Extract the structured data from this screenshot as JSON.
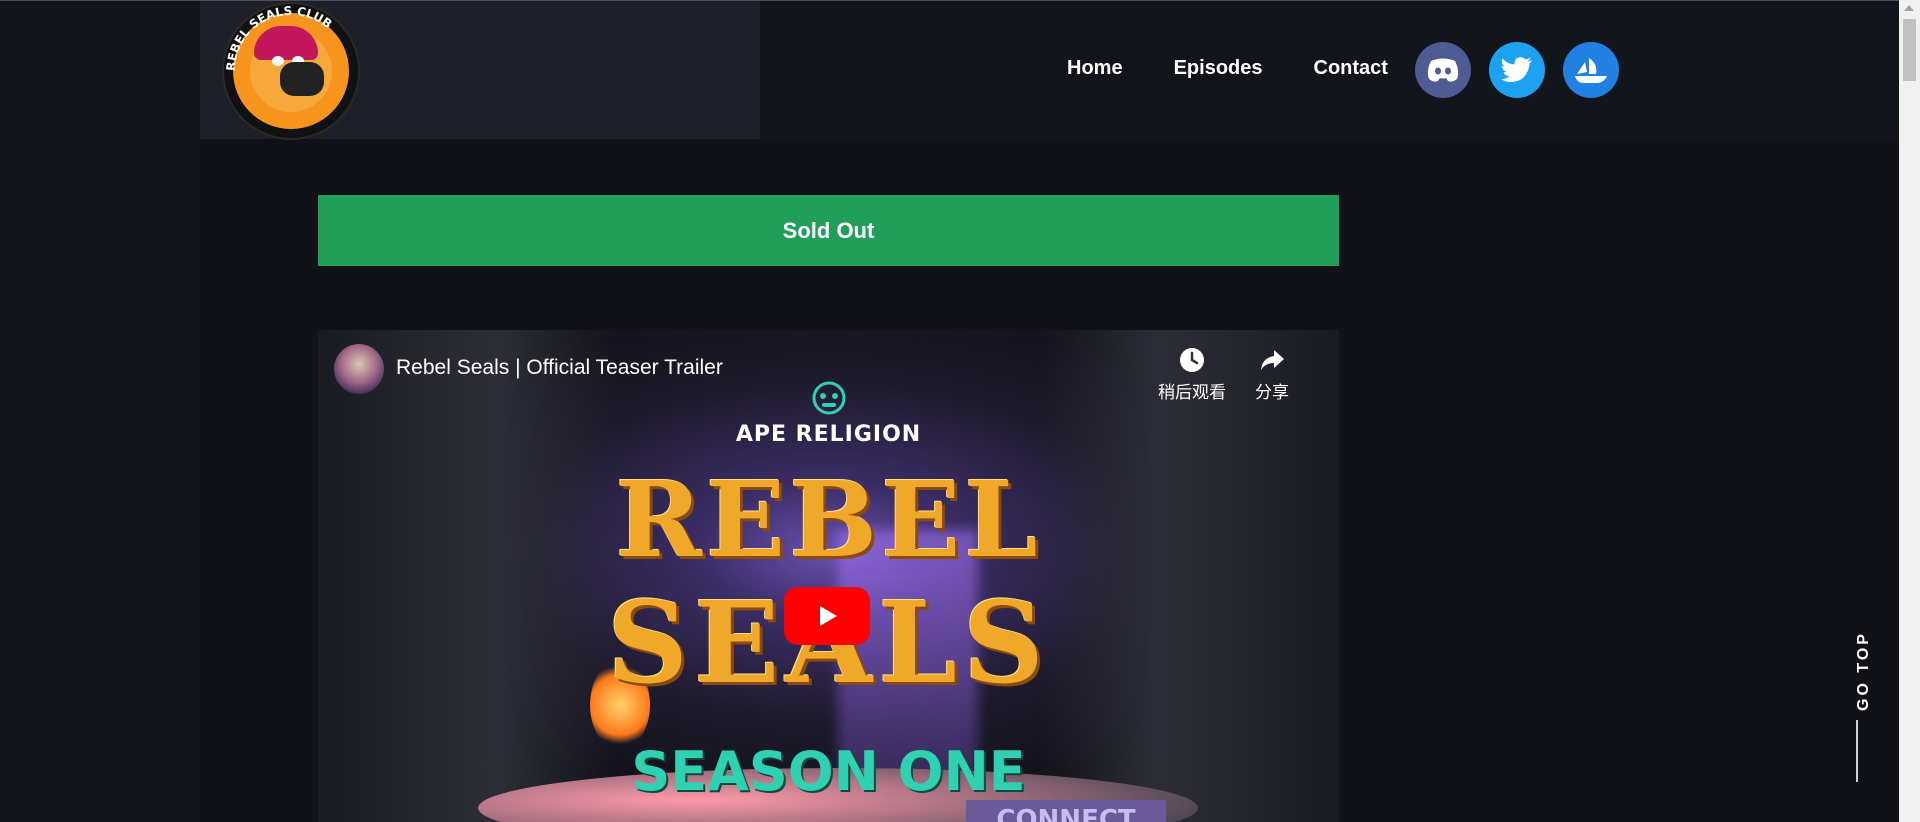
{
  "site": {
    "logo_text": "REBEL SEALS CLUB",
    "logo_text_alt": "REBEL SEALS CLUB"
  },
  "nav": {
    "items": [
      {
        "label": "Home"
      },
      {
        "label": "Episodes"
      },
      {
        "label": "Contact"
      }
    ]
  },
  "social": {
    "icons": [
      "discord-icon",
      "twitter-icon",
      "opensea-icon"
    ],
    "colors": {
      "discord": "#4f5b93",
      "twitter": "#1da1f2",
      "opensea": "#2081e2"
    }
  },
  "mint": {
    "button_label": "Sold Out",
    "color": "#219e5a"
  },
  "video": {
    "title": "Rebel Seals | Official Teaser Trailer",
    "watch_later_label": "稍后观看",
    "share_label": "分享",
    "thumbnail": {
      "brand": "APE RELIGION",
      "line1": "REBEL",
      "line2": "SEALS",
      "subtitle": "SEASON ONE",
      "sign": "CONNECT"
    }
  },
  "go_top": {
    "label": "GO TOP"
  }
}
